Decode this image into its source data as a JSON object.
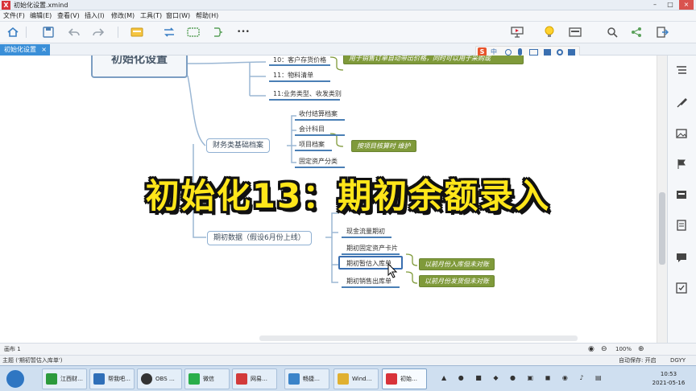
{
  "window": {
    "title": "初始化设置.xmind",
    "logo_letter": "X",
    "minimize": "–",
    "maximize": "□",
    "close": "×"
  },
  "menu": [
    "文件(F)",
    "编辑(E)",
    "查看(V)",
    "插入(I)",
    "修改(M)",
    "工具(T)",
    "窗口(W)",
    "帮助(H)"
  ],
  "toolbar": {
    "icons": [
      "home-icon",
      "save-icon",
      "undo-icon",
      "redo-icon",
      "theme-icon",
      "relationship-icon",
      "boundary-icon",
      "summary-icon",
      "more-icon",
      "presentation-icon",
      "lightbulb-icon",
      "slides-icon",
      "search-icon",
      "share-icon",
      "export-icon"
    ],
    "more_label": "•••"
  },
  "tab": {
    "label": "初始化设置",
    "close": "×"
  },
  "mindmap": {
    "root": "初始化设置",
    "top_items": [
      "10：客户存货价格",
      "11：物料清单",
      "11:业务类型、收发类别"
    ],
    "top_callout": "用于销售订单自动带出价格，同时可以用于采购或",
    "branch_finance": "财务类基础档案",
    "finance_items": [
      "收付结算档案",
      "会计科目",
      "项目档案",
      "固定资产分类"
    ],
    "finance_callout": "按项目核算时 维护",
    "branch_opening": "期初数据（假设6月份上线）",
    "opening_items": [
      "现金流量期初",
      "期初固定资产卡片",
      "期初暂估入库单",
      "期初销售出库单"
    ],
    "callout_inbound": "以前月份入库但未对账",
    "callout_outbound": "以前月份发货但未对账"
  },
  "overlay_title": "初始化13：期初余额录入",
  "sheet": {
    "name": "画布 1",
    "zoom": "100%",
    "minus": "⊖",
    "plus": "⊕"
  },
  "status": {
    "topic": "主题 ('期初暂估入库单')",
    "autosave": "自动保存: 开启",
    "user": "DGYY"
  },
  "ime": {
    "label": "中"
  },
  "taskbar": {
    "items": [
      {
        "label": "江西财…",
        "color": "#2c9a3c"
      },
      {
        "label": "帮我吧…",
        "color": "#2f6fb8"
      },
      {
        "label": "OBS …",
        "color": "#333333"
      },
      {
        "label": "微信",
        "color": "#2aae4a"
      },
      {
        "label": "网易…",
        "color": "#d23a3a"
      },
      {
        "label": "畅捷…",
        "color": "#3b84c9"
      },
      {
        "label": "Wind…",
        "color": "#e0b030"
      },
      {
        "label": "初始…",
        "color": "#d8333a"
      }
    ],
    "time": "10:53",
    "date": "2021-05-16"
  },
  "colors": {
    "accent": "#3a8fd8",
    "callout": "#7f9a3a",
    "overlay_text": "#ffe61a",
    "node_border": "#8fb0d2"
  }
}
